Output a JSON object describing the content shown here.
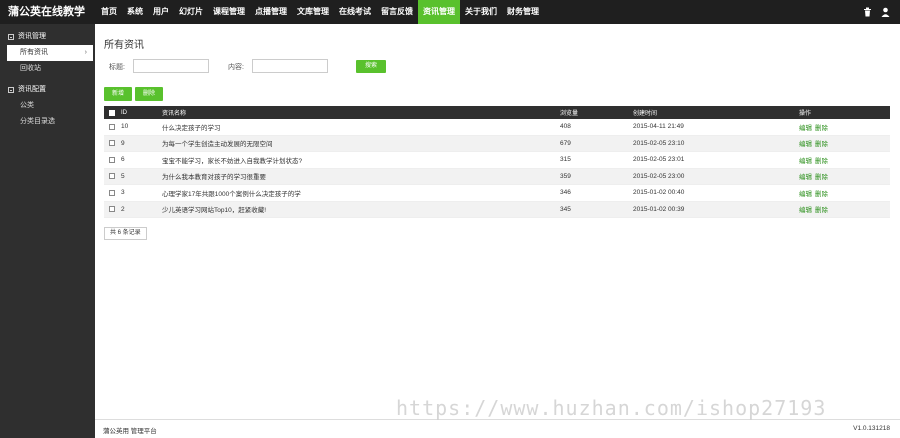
{
  "app": {
    "brand": "蒲公英在线教学"
  },
  "nav": {
    "items": [
      {
        "label": "首页"
      },
      {
        "label": "系统"
      },
      {
        "label": "用户"
      },
      {
        "label": "幻灯片"
      },
      {
        "label": "课程管理"
      },
      {
        "label": "点播管理"
      },
      {
        "label": "文库管理"
      },
      {
        "label": "在线考试"
      },
      {
        "label": "留言反馈"
      },
      {
        "label": "资讯管理",
        "active": true
      },
      {
        "label": "关于我们"
      },
      {
        "label": "财务管理"
      }
    ]
  },
  "top_icons": [
    "trash-icon",
    "user-icon"
  ],
  "sidebar": {
    "group1": {
      "label": "资讯管理"
    },
    "group1_items": [
      {
        "label": "所有资讯",
        "active": true
      },
      {
        "label": "回收站"
      }
    ],
    "group2": {
      "label": "资讯配置"
    },
    "group2_items": [
      {
        "label": "公类"
      },
      {
        "label": "分类目录选"
      }
    ]
  },
  "main": {
    "title": "所有资讯",
    "search": {
      "title_label": "标题:",
      "content_label": "内容:",
      "title_value": "",
      "content_value": "",
      "search_button": "搜索"
    },
    "actions": {
      "add": "新增",
      "delete": "删除"
    },
    "table": {
      "headers": {
        "id": "ID",
        "name": "资讯名称",
        "views": "浏览量",
        "time": "创建时间",
        "op": "操作"
      },
      "rows": [
        {
          "id": "10",
          "name": "什么决定孩子的学习",
          "views": "408",
          "time": "2015-04-11 21:49",
          "edit": "编辑",
          "del": "删除"
        },
        {
          "id": "9",
          "name": "为每一个学生创造主动发展的无限空间",
          "views": "679",
          "time": "2015-02-05 23:10",
          "edit": "编辑",
          "del": "删除"
        },
        {
          "id": "6",
          "name": "宝宝不能学习，家长不妨进入自我教学计划状态?",
          "views": "315",
          "time": "2015-02-05 23:01",
          "edit": "编辑",
          "del": "删除"
        },
        {
          "id": "5",
          "name": "为什么我本教育对孩子的学习很重要",
          "views": "359",
          "time": "2015-02-05 23:00",
          "edit": "编辑",
          "del": "删除"
        },
        {
          "id": "3",
          "name": "心理学家17年共跟1000个案例什么决定孩子的学",
          "views": "346",
          "time": "2015-01-02 00:40",
          "edit": "编辑",
          "del": "删除"
        },
        {
          "id": "2",
          "name": "少儿英语学习网站Top10，赶紧收藏!",
          "views": "345",
          "time": "2015-01-02 00:39",
          "edit": "编辑",
          "del": "删除"
        }
      ]
    },
    "total": "共 6 条记录"
  },
  "footer": {
    "left": "蒲公英用 管理平台",
    "right": "V1.0.131218"
  },
  "watermark": "https://www.huzhan.com/ishop27193",
  "colors": {
    "accent": "#59c12d",
    "topbar": "#1f1f1f",
    "sidebar": "#2f2f2f",
    "link": "#2a8f1a"
  }
}
